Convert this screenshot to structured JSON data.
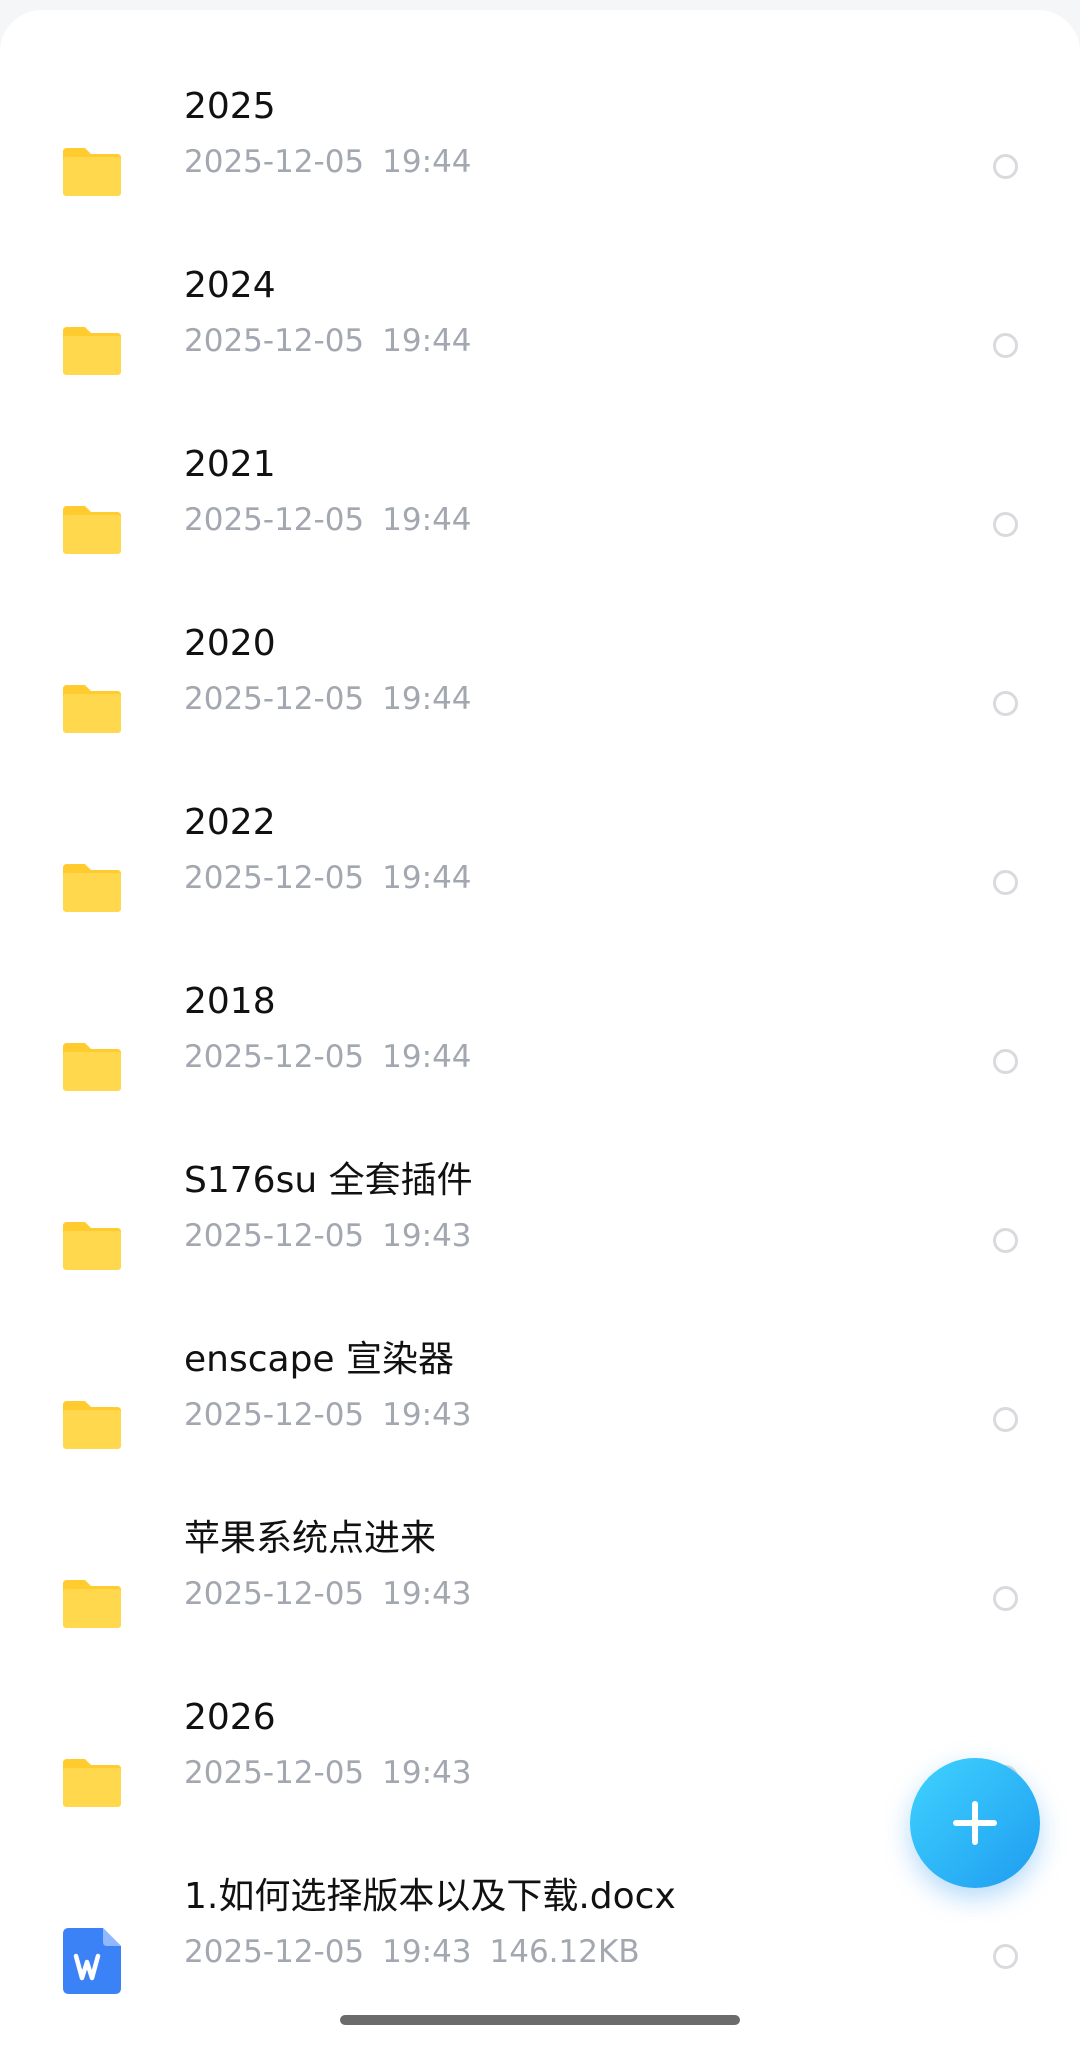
{
  "file_list": {
    "items": [
      {
        "name": "2025",
        "date": "2025-12-05",
        "time": "19:44",
        "size": "",
        "icon": "folder-icon"
      },
      {
        "name": "2024",
        "date": "2025-12-05",
        "time": "19:44",
        "size": "",
        "icon": "folder-icon"
      },
      {
        "name": "2021",
        "date": "2025-12-05",
        "time": "19:44",
        "size": "",
        "icon": "folder-icon"
      },
      {
        "name": "2020",
        "date": "2025-12-05",
        "time": "19:44",
        "size": "",
        "icon": "folder-icon"
      },
      {
        "name": "2022",
        "date": "2025-12-05",
        "time": "19:44",
        "size": "",
        "icon": "folder-icon"
      },
      {
        "name": "2018",
        "date": "2025-12-05",
        "time": "19:44",
        "size": "",
        "icon": "folder-icon"
      },
      {
        "name": "S176su 全套插件",
        "date": "2025-12-05",
        "time": "19:43",
        "size": "",
        "icon": "folder-icon"
      },
      {
        "name": "enscape 宣染器",
        "date": "2025-12-05",
        "time": "19:43",
        "size": "",
        "icon": "folder-icon"
      },
      {
        "name": "苹果系统点进来",
        "date": "2025-12-05",
        "time": "19:43",
        "size": "",
        "icon": "folder-icon"
      },
      {
        "name": "2026",
        "date": "2025-12-05",
        "time": "19:43",
        "size": "",
        "icon": "folder-icon"
      },
      {
        "name": "1.如何选择版本以及下载.docx",
        "date": "2025-12-05",
        "time": "19:43",
        "size": "146.12KB",
        "icon": "word-document-icon"
      }
    ]
  },
  "fab": {
    "icon": "plus-icon"
  },
  "colors": {
    "folder": "#ffd84d",
    "folder_tab": "#ffcb2e",
    "word_doc": "#3b82f6",
    "fab_start": "#3fd3ff",
    "fab_end": "#1f9cf0",
    "meta_text": "#a2a7b0",
    "name_text": "#111111"
  }
}
